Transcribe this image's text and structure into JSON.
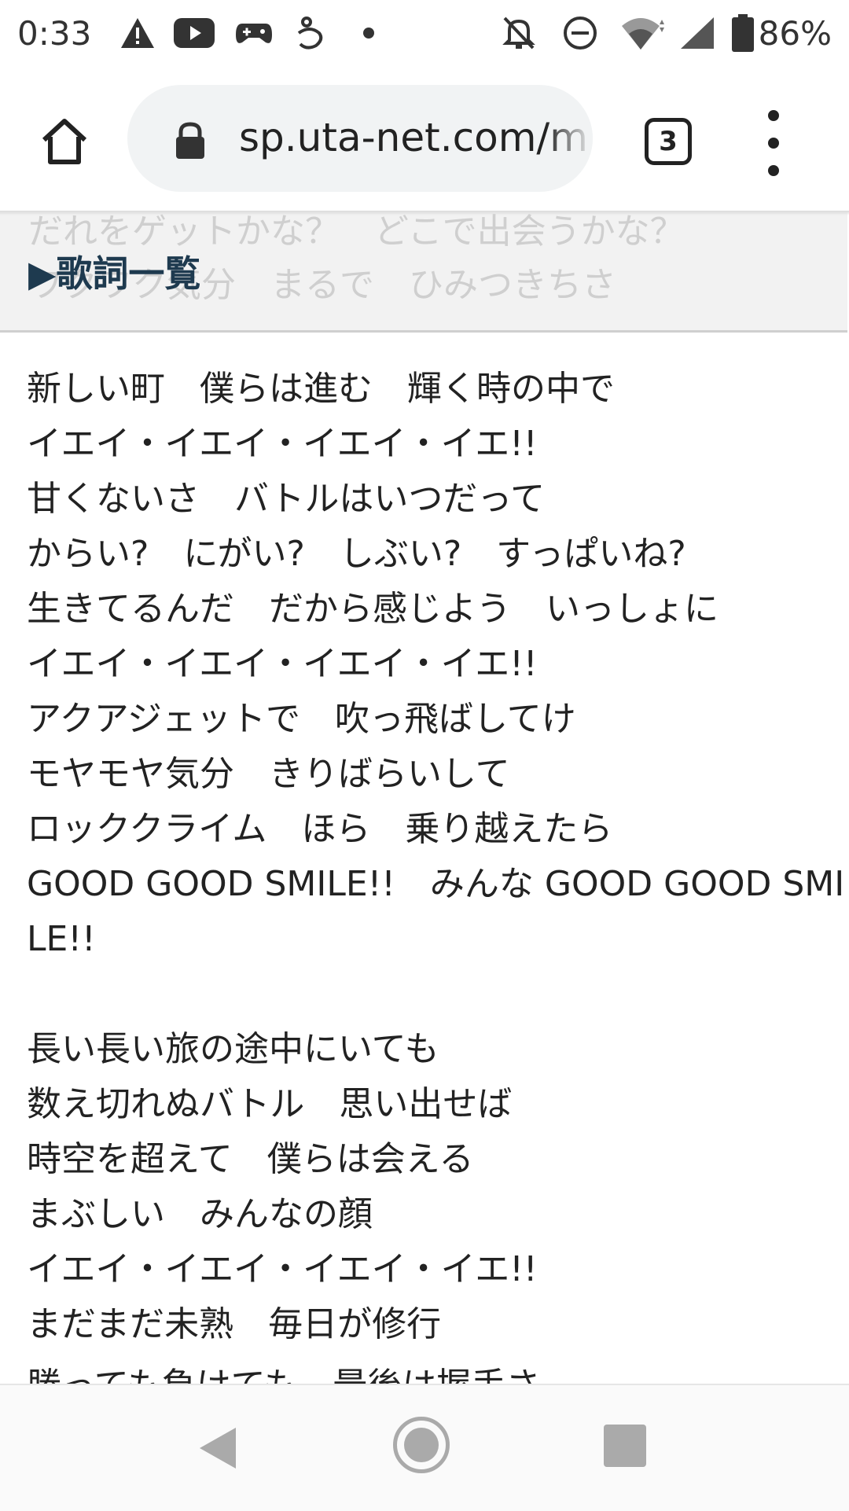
{
  "status_bar": {
    "time": "0:33",
    "battery_percent": "86%",
    "icons": [
      "warning-icon",
      "youtube-icon",
      "game-controller-icon",
      "app-icon",
      "dot-icon",
      "notifications-off-icon",
      "dnd-icon",
      "wifi-icon",
      "signal-icon",
      "battery-icon"
    ]
  },
  "browser": {
    "url": "sp.uta-net.com/m",
    "tab_count": "3"
  },
  "sticky_header": {
    "title": "▶歌詞一覧",
    "ghost_lines": [
      "だれをゲットかな？　どこで出会うかな？",
      "ワクワク気分　まるで　ひみつきちさ"
    ]
  },
  "lyrics": {
    "stanza1": [
      "新しい町　僕らは進む　輝く時の中で",
      "イエイ・イエイ・イエイ・イエ!!",
      "甘くないさ　バトルはいつだって",
      "からい?　にがい?　しぶい?　すっぱいね?",
      "生きてるんだ　だから感じよう　いっしょに",
      "イエイ・イエイ・イエイ・イエ!!",
      "アクアジェットで　吹っ飛ばしてけ",
      "モヤモヤ気分　きりばらいして",
      "ロッククライム　ほら　乗り越えたら",
      "GOOD GOOD SMILE!!　みんな GOOD GOOD SMI",
      "LE!!"
    ],
    "stanza2": [
      "長い長い旅の途中にいても",
      "数え切れぬバトル　思い出せば",
      "時空を超えて　僕らは会える",
      "まぶしい　みんなの顔",
      "イエイ・イエイ・イエイ・イエ!!",
      "まだまだ未熟　毎日が修行"
    ],
    "cut_line": "勝っても負けても　最後は握手さ"
  }
}
